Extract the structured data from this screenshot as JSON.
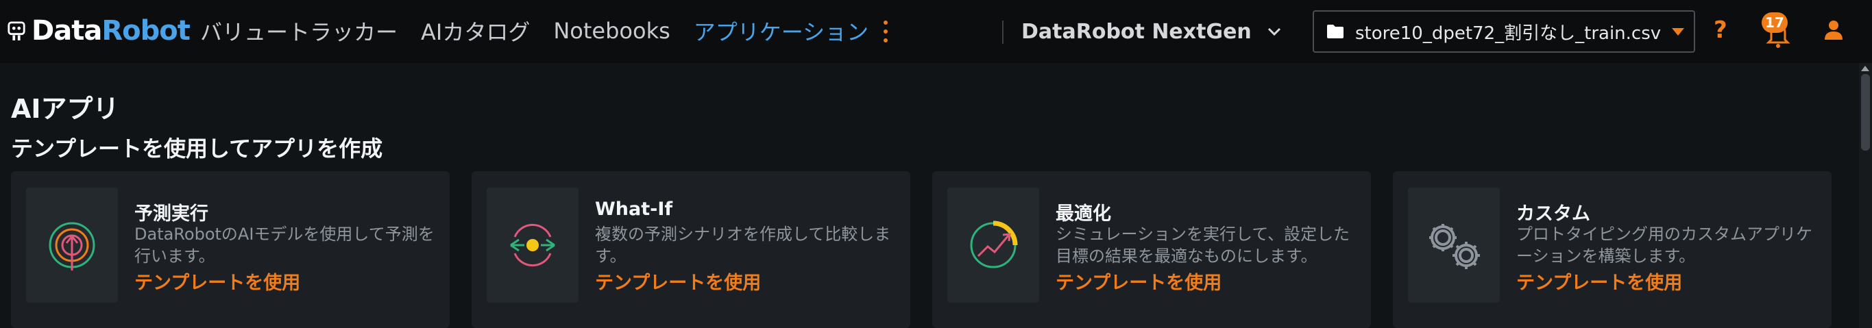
{
  "header": {
    "logo": {
      "part1": "Data",
      "part2": "Robot"
    },
    "nav": [
      {
        "label": "バリュートラッカー",
        "active": false
      },
      {
        "label": "AIカタログ",
        "active": false
      },
      {
        "label": "Notebooks",
        "active": false
      },
      {
        "label": "アプリケーション",
        "active": true
      }
    ],
    "workspace": "DataRobot NextGen",
    "file_select": "store10_dpet72_割引なし_train.csv",
    "notification_count": "17",
    "icons": {
      "more": "kebab-vertical-icon",
      "workspace_caret": "chevron-down-icon",
      "file": "folder-icon",
      "help": "question-icon",
      "notifications": "bell-icon",
      "user": "user-icon"
    }
  },
  "main": {
    "title": "AIアプリ",
    "subtitle": "テンプレートを使用してアプリを作成",
    "cards": [
      {
        "title": "予測実行",
        "description": "DataRobotのAIモデルを使用して予測を行います。",
        "link": "テンプレートを使用",
        "icon": "target-arrow-icon"
      },
      {
        "title": "What-If",
        "description": "複数の予測シナリオを作成して比較します。",
        "link": "テンプレートを使用",
        "icon": "scenario-cycle-icon"
      },
      {
        "title": "最適化",
        "description": "シミュレーションを実行して、設定した目標の結果を最適なものにします。",
        "link": "テンプレートを使用",
        "icon": "optimize-chart-icon"
      },
      {
        "title": "カスタム",
        "description": "プロトタイピング用のカスタムアプリケーションを構築します。",
        "link": "テンプレートを使用",
        "icon": "gears-icon"
      }
    ]
  },
  "colors": {
    "accent": "#f07d1a",
    "active_nav": "#4aa3e8",
    "background": "#111417",
    "card": "#1c2024"
  }
}
